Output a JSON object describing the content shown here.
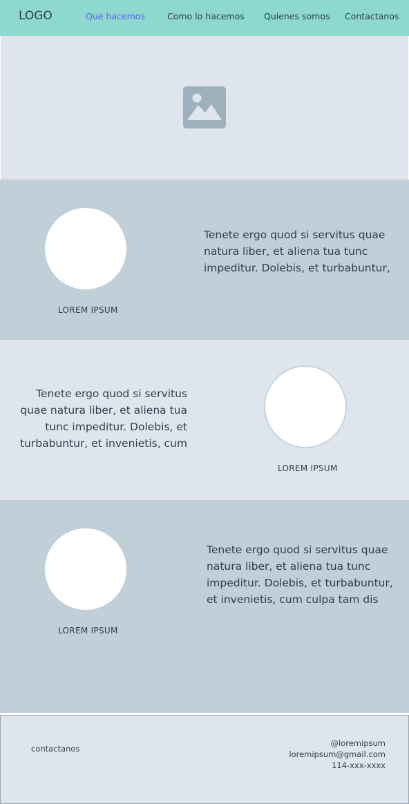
{
  "nav": {
    "logo": "LOGO",
    "links": [
      "Que hacemos",
      "Como lo hacemos",
      "Quienes somos",
      "Contactanos"
    ],
    "active_index": 0,
    "bg_color": "#8ed9cf",
    "active_color": "#5b5cf0"
  },
  "hero": {
    "icon": "image-placeholder-icon"
  },
  "sections": [
    {
      "caption": "LOREM IPSUM",
      "text": "Tenete ergo quod si servitus quae natura liber, et aliena tua tunc impeditur. Dolebis, et turbabuntur,"
    },
    {
      "caption": "LOREM IPSUM",
      "text": "Tenete ergo quod si servitus quae natura liber, et aliena tua tunc impeditur. Dolebis, et turbabuntur, et invenietis, cum"
    },
    {
      "caption": "LOREM IPSUM",
      "text": "Tenete ergo quod si servitus quae natura liber, et aliena tua tunc impeditur. Dolebis, et turbabuntur, et invenietis, cum culpa tam dis"
    }
  ],
  "footer": {
    "label": "contactanos",
    "handle": "@loremipsum",
    "email": "loremipsum@gmail.com",
    "phone": "114-xxx-xxxx"
  }
}
